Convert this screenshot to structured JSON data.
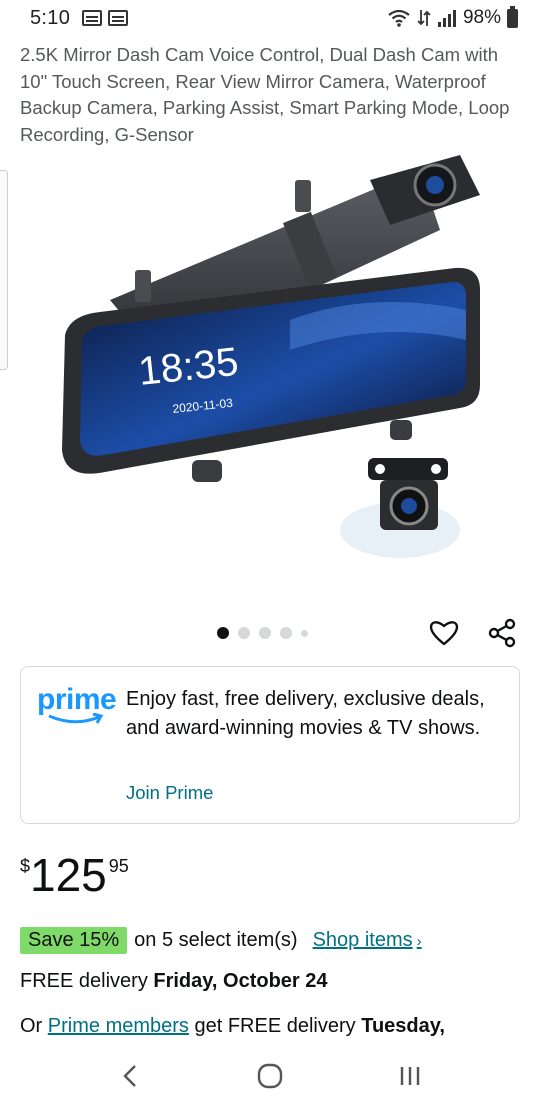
{
  "status_bar": {
    "time": "5:10",
    "battery": "98%",
    "notification_icons": [
      "calendar-icon",
      "calendar-icon"
    ],
    "system_icons": [
      "wifi-icon",
      "signal-icon",
      "battery-icon"
    ]
  },
  "product": {
    "title": "2.5K Mirror Dash Cam Voice Control, Dual Dash Cam with 10\" Touch Screen, Rear View Mirror Camera, Waterproof Backup Camera, Parking Assist, Smart Parking Mode, Loop Recording, G-Sensor",
    "image": {
      "screen_time": "18:35",
      "screen_date": "2020-11-03"
    },
    "carousel": {
      "total": 5,
      "active": 1
    }
  },
  "prime": {
    "logo_text": "prime",
    "description": "Enjoy fast, free delivery, exclusive deals, and award-winning movies & TV shows.",
    "join_label": "Join Prime"
  },
  "price": {
    "symbol": "$",
    "whole": "125",
    "fraction": "95"
  },
  "promo": {
    "badge": "Save 15%",
    "text": "on 5 select item(s)",
    "link": "Shop items"
  },
  "delivery": {
    "prefix": "FREE delivery ",
    "date": "Friday, October 24"
  },
  "alt_delivery": {
    "prefix": "Or ",
    "link": "Prime members",
    "middle": " get FREE delivery ",
    "date": "Tuesday,"
  },
  "colors": {
    "link": "#007185",
    "prime_blue": "#1a98ff",
    "save_badge": "#7fda69",
    "text": "#0f1111"
  }
}
